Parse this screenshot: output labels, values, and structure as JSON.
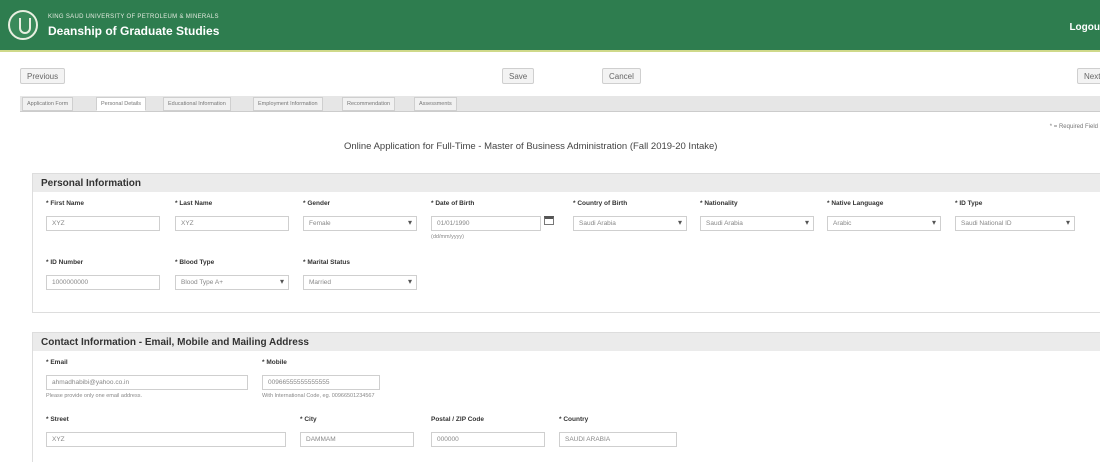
{
  "header": {
    "university": "KING SAUD UNIVERSITY OF PETROLEUM & MINERALS",
    "deanship": "Deanship of Graduate Studies",
    "logout": "Logou"
  },
  "toolbar": {
    "previous": "Previous",
    "save": "Save",
    "cancel": "Cancel",
    "next": "Next"
  },
  "tabs": [
    "Application Form",
    "Personal Details",
    "Educational Information",
    "Employment Information",
    "Recommendation",
    "Assessments"
  ],
  "active_tab": "Personal Details",
  "required_note": "* = Required Field",
  "page_title": "Online Application for Full-Time - Master of Business Administration (Fall 2019-20 Intake)",
  "personal": {
    "heading": "Personal Information",
    "first_name": {
      "label": "* First Name",
      "value": "XYZ"
    },
    "last_name": {
      "label": "* Last Name",
      "value": "XYZ"
    },
    "gender": {
      "label": "* Gender",
      "value": "Female"
    },
    "dob": {
      "label": "* Date of Birth",
      "value": "01/01/1990",
      "hint": "(dd/mm/yyyy)"
    },
    "country_birth": {
      "label": "* Country of Birth",
      "value": "Saudi Arabia"
    },
    "nationality": {
      "label": "* Nationality",
      "value": "Saudi Arabia"
    },
    "native_language": {
      "label": "* Native Language",
      "value": "Arabic"
    },
    "id_type": {
      "label": "* ID Type",
      "value": "Saudi National ID"
    },
    "id_number": {
      "label": "* ID Number",
      "value": "1000000000"
    },
    "blood_type": {
      "label": "* Blood Type",
      "value": "Blood Type A+"
    },
    "marital": {
      "label": "* Marital Status",
      "value": "Married"
    }
  },
  "contact": {
    "heading": "Contact Information - Email, Mobile and Mailing Address",
    "email": {
      "label": "* Email",
      "value": "ahmadhabibi@yahoo.co.in",
      "hint": "Please provide only one email address."
    },
    "mobile": {
      "label": "* Mobile",
      "value": "00966555555555555",
      "hint": "With International Code, eg. 00966501234567"
    },
    "street": {
      "label": "* Street",
      "value": "XYZ"
    },
    "city": {
      "label": "* City",
      "value": "DAMMAM"
    },
    "postal": {
      "label": "Postal / ZIP Code",
      "value": "000000"
    },
    "country": {
      "label": "* Country",
      "value": "SAUDI ARABIA"
    }
  },
  "colors": {
    "header_bg": "#2e7d4f",
    "header_stripe": "#cfd98a",
    "section_head_bg": "#ebebeb"
  },
  "icons": [
    "university-seal-icon",
    "calendar-icon",
    "chevron-down-icon"
  ]
}
